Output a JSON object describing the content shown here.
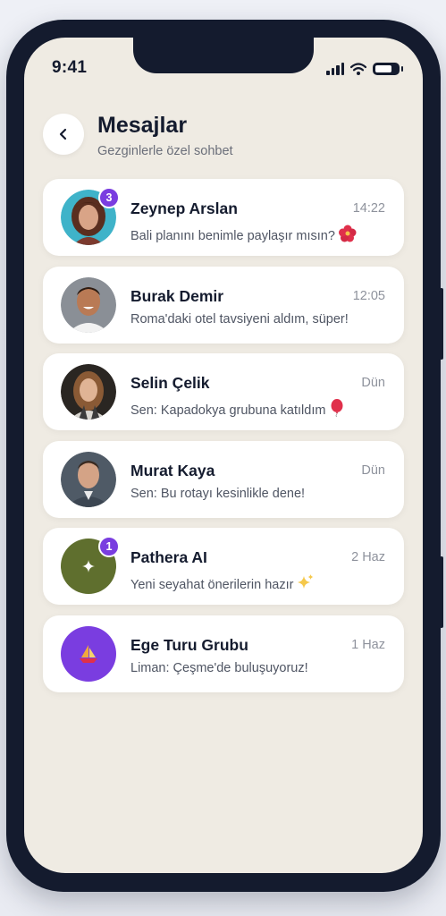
{
  "status_bar": {
    "time": "9:41"
  },
  "header": {
    "back_icon": "chevron-left-icon",
    "title": "Mesajlar",
    "subtitle": "Gezginlerle özel sohbet"
  },
  "colors": {
    "accent": "#7a3de0",
    "background": "#efebe3",
    "frame": "#141b2e",
    "ai_avatar": "#5f6f2e"
  },
  "conversations": [
    {
      "name": "Zeynep Arslan",
      "time": "14:22",
      "preview": "Bali planını benimle paylaşır mısın?",
      "preview_emoji": "hibiscus",
      "badge": "3",
      "avatar": "photo-woman-1"
    },
    {
      "name": "Burak Demir",
      "time": "12:05",
      "preview": "Roma'daki otel tavsiyeni aldım, süper!",
      "avatar": "photo-man-1"
    },
    {
      "name": "Selin Çelik",
      "time": "Dün",
      "preview": "Sen: Kapadokya grubuna katıldım",
      "preview_emoji": "balloon",
      "avatar": "photo-woman-2"
    },
    {
      "name": "Murat Kaya",
      "time": "Dün",
      "preview": "Sen: Bu rotayı kesinlikle dene!",
      "avatar": "photo-man-2"
    },
    {
      "name": "Pathera AI",
      "time": "2 Haz",
      "preview": "Yeni seyahat önerilerin hazır",
      "preview_emoji": "sparkles",
      "badge": "1",
      "avatar": "sparkle-icon"
    },
    {
      "name": "Ege Turu Grubu",
      "time": "1 Haz",
      "preview": "Liman: Çeşme'de buluşuyoruz!",
      "avatar": "sailboat-icon"
    }
  ]
}
